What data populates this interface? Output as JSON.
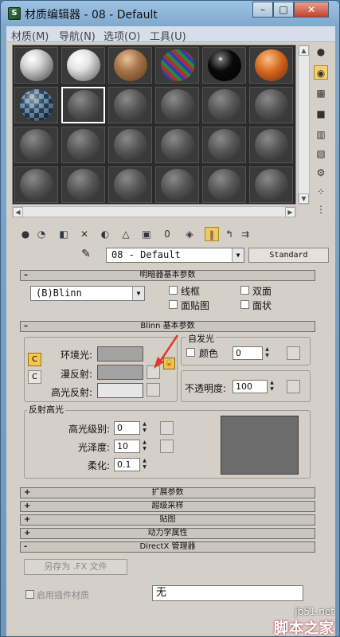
{
  "window": {
    "title": "材质编辑器 - 08 - Default",
    "min_label": "–",
    "max_label": "□",
    "close_label": "✕"
  },
  "menu": [
    "材质(M)",
    "导航(N)",
    "选项(O)",
    "工具(U)"
  ],
  "slots": [
    [
      "white",
      "white2",
      "brown",
      "rgb",
      "black",
      "orange"
    ],
    [
      "check",
      "gray-active",
      "gray",
      "gray",
      "gray",
      "gray"
    ],
    [
      "gray",
      "gray",
      "gray",
      "gray",
      "gray",
      "gray"
    ],
    [
      "gray",
      "gray",
      "gray",
      "gray",
      "gray",
      "gray"
    ]
  ],
  "name_row": {
    "material_name": "08 - Default",
    "type_button": "Standard"
  },
  "shader_basic": {
    "header": "明暗器基本参数",
    "shader": "(B)Blinn",
    "wire": "线框",
    "two_sided": "双面",
    "face_map": "面贴图",
    "faceted": "面状"
  },
  "blinn_basic": {
    "header": "Blinn 基本参数",
    "ambient": "环境光:",
    "diffuse": "漫反射:",
    "specular": "高光反射:",
    "self_illum_group": "自发光",
    "color_label": "颜色",
    "self_illum_value": "0",
    "opacity_label": "不透明度:",
    "opacity_value": "100",
    "lock_side_1": "C",
    "lock_side_2": "C"
  },
  "specular_highlights": {
    "group": "反射高光",
    "level_label": "高光级别:",
    "level_value": "0",
    "gloss_label": "光泽度:",
    "gloss_value": "10",
    "soften_label": "柔化:",
    "soften_value": "0.1"
  },
  "rollouts": [
    {
      "sign": "+",
      "label": "扩展参数"
    },
    {
      "sign": "+",
      "label": "超级采样"
    },
    {
      "sign": "+",
      "label": "贴图"
    },
    {
      "sign": "+",
      "label": "动力学属性"
    },
    {
      "sign": "-",
      "label": "DirectX 管理器"
    }
  ],
  "directx": {
    "save_fx": "另存为 .FX 文件",
    "enable_plugin": "启用插件材质",
    "plugin_value": "无"
  },
  "watermark": {
    "domain": "jb51.net",
    "name": "脚本之家"
  },
  "colors": {
    "ambient": "#a3a3a3",
    "diffuse": "#a3a3a3",
    "specular": "#e6e6e6",
    "highlight_lock": "#f2c14e",
    "annotation_arrow": "#e03a2a"
  }
}
